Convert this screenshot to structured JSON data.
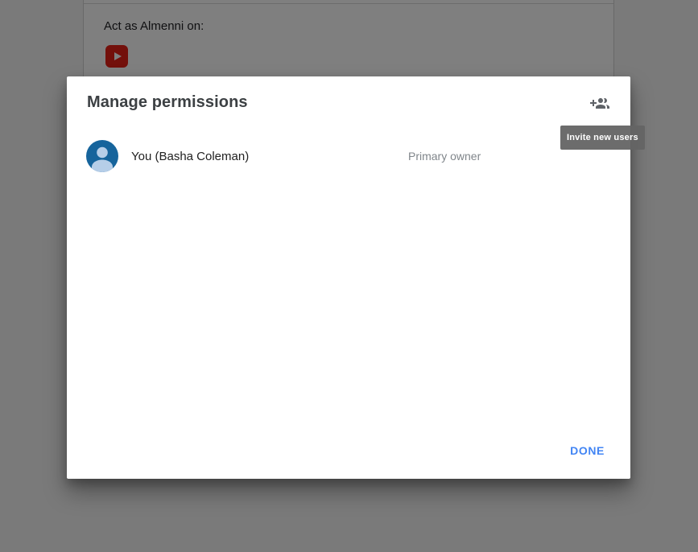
{
  "page": {
    "card": {
      "act_as_label": "Act as Almenni on:"
    }
  },
  "dialog": {
    "title": "Manage permissions",
    "invite_tooltip": "Invite new users",
    "members": [
      {
        "name": "You (Basha Coleman)",
        "role": "Primary owner"
      }
    ],
    "done_label": "DONE"
  },
  "icons": {
    "invite": "group-add-icon",
    "avatar": "person-icon",
    "platform": "youtube-icon"
  },
  "colors": {
    "accent_blue": "#4285F4",
    "avatar_blue": "#16649C",
    "avatar_light": "#B6CEE8",
    "youtube_red": "#E62117",
    "tooltip_bg": "#646464",
    "title_gray": "#3C4043",
    "role_gray": "#80868B"
  }
}
